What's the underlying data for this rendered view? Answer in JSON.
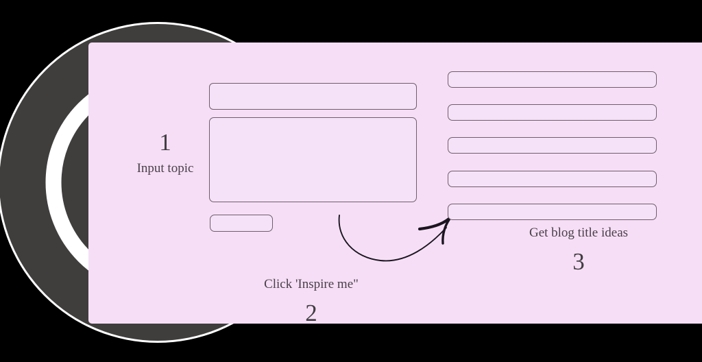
{
  "colors": {
    "page_background": "#000000",
    "logo_disc": "#403d3d",
    "logo_ring": "#ffffff",
    "card_background": "#f6dff6",
    "field_background": "#f6e2f8",
    "field_border": "#6e5d6c",
    "text": "#423d42",
    "arrow": "#1b1520"
  },
  "logo": {
    "disc_icon": "filled-circle-icon",
    "ring_icon": "ring-icon"
  },
  "card": {
    "steps": [
      {
        "number": "1",
        "caption": "Input topic"
      },
      {
        "number": "2",
        "caption": "Click 'Inspire me\""
      },
      {
        "number": "3",
        "caption": "Get blog title ideas"
      }
    ],
    "form": {
      "topic_input": {
        "value": "",
        "placeholder": ""
      },
      "details_textarea": {
        "value": "",
        "placeholder": ""
      },
      "inspire_button": {
        "label": ""
      }
    },
    "results": {
      "rows": [
        {
          "text": ""
        },
        {
          "text": ""
        },
        {
          "text": ""
        },
        {
          "text": ""
        },
        {
          "text": ""
        }
      ]
    },
    "arrow": {
      "icon": "curved-arrow-right-icon"
    }
  }
}
